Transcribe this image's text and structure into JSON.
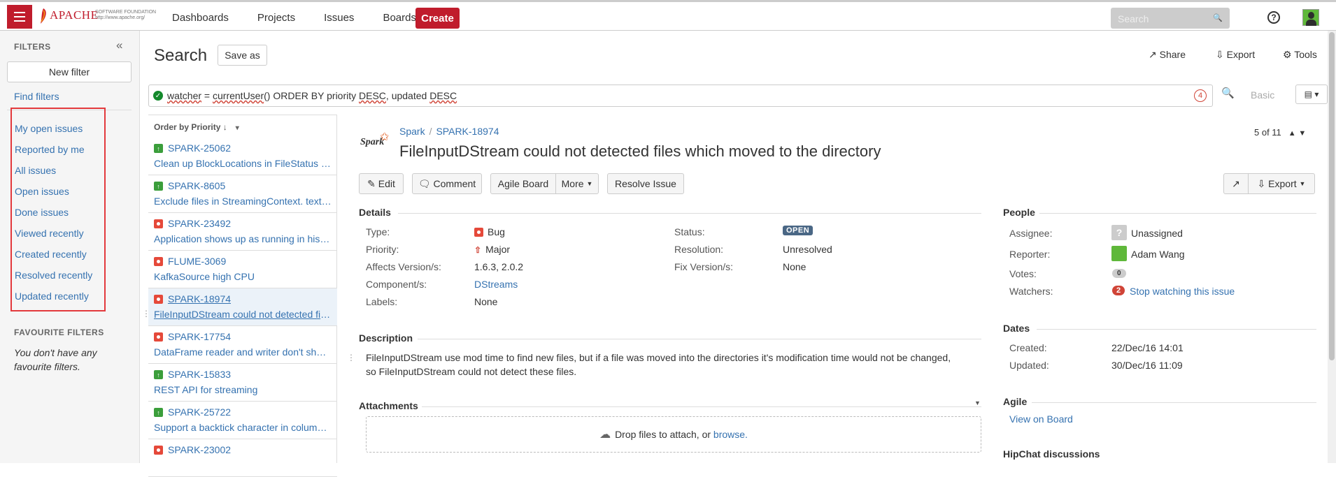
{
  "topbar": {
    "logo_text": "APACHE",
    "logo_sub1": "SOFTWARE FOUNDATION",
    "logo_sub2": "http://www.apache.org/",
    "nav": [
      "Dashboards",
      "Projects",
      "Issues",
      "Boards"
    ],
    "create_label": "Create",
    "search_placeholder": "Search"
  },
  "sidebar": {
    "heading": "FILTERS",
    "new_filter_label": "New filter",
    "find_filters_label": "Find filters",
    "filters": [
      "My open issues",
      "Reported by me",
      "All issues",
      "Open issues",
      "Done issues",
      "Viewed recently",
      "Created recently",
      "Resolved recently",
      "Updated recently"
    ],
    "favourite_heading": "FAVOURITE FILTERS",
    "favourite_note": "You don't have any favourite filters."
  },
  "header": {
    "title": "Search",
    "save_as_label": "Save as",
    "share_label": "Share",
    "export_label": "Export",
    "tools_label": "Tools"
  },
  "jql": {
    "parts": {
      "watcher": "watcher",
      "eq": " = ",
      "fn": "currentUser",
      "paren": "()",
      "order": " ORDER BY priority ",
      "desc1": "DESC",
      "comma": ", updated ",
      "desc2": "DESC"
    },
    "count": "4",
    "basic_label": "Basic"
  },
  "issue_list": {
    "order_label": "Order by Priority",
    "items": [
      {
        "key": "SPARK-25062",
        "summary": "Clean up BlockLocations in FileStatus objects",
        "type": "improvement"
      },
      {
        "key": "SPARK-8605",
        "summary": "Exclude files in StreamingContext. textFileStream",
        "type": "improvement"
      },
      {
        "key": "SPARK-23492",
        "summary": "Application shows up as running in history server",
        "type": "bug"
      },
      {
        "key": "FLUME-3069",
        "summary": "KafkaSource high CPU",
        "type": "bug"
      },
      {
        "key": "SPARK-18974",
        "summary": "FileInputDStream could not detected files which moved",
        "type": "bug"
      },
      {
        "key": "SPARK-17754",
        "summary": "DataFrame reader and writer don't show the path",
        "type": "bug"
      },
      {
        "key": "SPARK-15833",
        "summary": "REST API for streaming",
        "type": "improvement"
      },
      {
        "key": "SPARK-25722",
        "summary": "Support a backtick character in column names",
        "type": "improvement"
      },
      {
        "key": "SPARK-23002",
        "summary": "",
        "type": "bug"
      }
    ]
  },
  "issue": {
    "project": "Spark",
    "key": "SPARK-18974",
    "title": "FileInputDStream could not detected files which moved to the directory",
    "pager": "5 of 11",
    "buttons": {
      "edit": "Edit",
      "comment": "Comment",
      "agile_board": "Agile Board",
      "more": "More",
      "resolve": "Resolve Issue",
      "export": "Export"
    },
    "details_heading": "Details",
    "fields": {
      "type_label": "Type:",
      "type_value": "Bug",
      "priority_label": "Priority:",
      "priority_value": "Major",
      "affects_label": "Affects Version/s:",
      "affects_value": "1.6.3, 2.0.2",
      "component_label": "Component/s:",
      "component_value": "DStreams",
      "labels_label": "Labels:",
      "labels_value": "None",
      "status_label": "Status:",
      "status_value": "OPEN",
      "resolution_label": "Resolution:",
      "resolution_value": "Unresolved",
      "fix_label": "Fix Version/s:",
      "fix_value": "None"
    },
    "description_heading": "Description",
    "description_line1": "FileInputDStream use mod time to find new files, but if a file was moved into the directories it's modification time would not be changed,",
    "description_line2": "so FileInputDStream could not detect these files.",
    "attachments_heading": "Attachments",
    "drop_text": "Drop files to attach, or ",
    "browse_link": "browse.",
    "people": {
      "heading": "People",
      "assignee_label": "Assignee:",
      "assignee_value": "Unassigned",
      "reporter_label": "Reporter:",
      "reporter_value": "Adam Wang",
      "votes_label": "Votes:",
      "votes_value": "0",
      "watchers_label": "Watchers:",
      "watchers_count": "2",
      "watchers_link": "Stop watching this issue"
    },
    "dates": {
      "heading": "Dates",
      "created_label": "Created:",
      "created_value": "22/Dec/16 14:01",
      "updated_label": "Updated:",
      "updated_value": "30/Dec/16 11:09"
    },
    "agile": {
      "heading": "Agile",
      "link": "View on Board"
    },
    "hipchat_heading": "HipChat discussions"
  },
  "colors": {
    "brand_red": "#c01c2c",
    "link": "#3572b0",
    "status_open": "#4a6785",
    "highlight_box": "#e3393c"
  }
}
